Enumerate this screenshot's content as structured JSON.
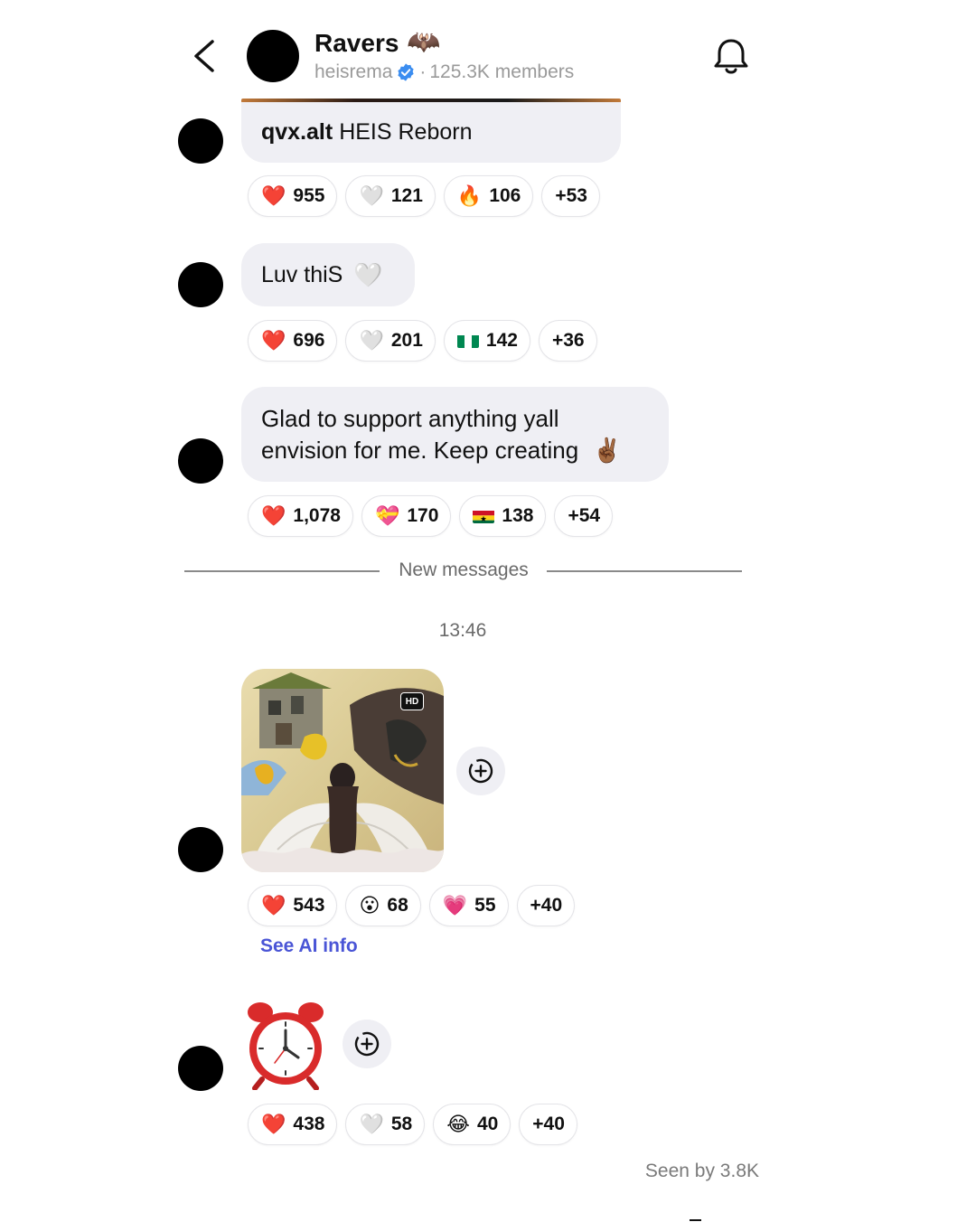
{
  "header": {
    "back_icon": "chevron-left-icon",
    "group_name": "Ravers",
    "group_emoji": "🦇",
    "owner": "heisrema",
    "verified_icon": "verified-badge-icon",
    "separator": "·",
    "members": "125.3K members",
    "bell_icon": "bell-icon"
  },
  "messages": [
    {
      "sender": "qvx.alt",
      "text": "HEIS Reborn",
      "reactions": [
        {
          "emoji": "❤️",
          "count": "955"
        },
        {
          "emoji": "🤍",
          "count": "121"
        },
        {
          "emoji": "🔥",
          "count": "106"
        },
        {
          "emoji": "",
          "count": "+53"
        }
      ]
    },
    {
      "text": "Luv thiS",
      "emoji": "🤍",
      "reactions": [
        {
          "emoji": "❤️",
          "count": "696"
        },
        {
          "emoji": "🤍",
          "count": "201"
        },
        {
          "emoji": "flag-nigeria",
          "count": "142"
        },
        {
          "emoji": "",
          "count": "+36"
        }
      ]
    },
    {
      "line1": "Glad to support anything yall",
      "line2": "envision for me. Keep creating",
      "emoji": "✌🏾",
      "reactions": [
        {
          "emoji": "❤️",
          "count": "1,078"
        },
        {
          "emoji": "💝",
          "count": "170"
        },
        {
          "emoji": "flag-ghana",
          "count": "138"
        },
        {
          "emoji": "",
          "count": "+54"
        }
      ]
    },
    {
      "hd_label": "HD",
      "add_icon": "add-reaction-icon",
      "reactions": [
        {
          "emoji": "❤️",
          "count": "543"
        },
        {
          "emoji": "😮",
          "count": "68"
        },
        {
          "emoji": "💗",
          "count": "55"
        },
        {
          "emoji": "",
          "count": "+40"
        }
      ],
      "link": "See AI info"
    },
    {
      "emoji": "⏰",
      "add_icon": "add-reaction-icon",
      "reactions": [
        {
          "emoji": "❤️",
          "count": "438"
        },
        {
          "emoji": "🤍",
          "count": "58"
        },
        {
          "emoji": "😂",
          "count": "40"
        },
        {
          "emoji": "",
          "count": "+40"
        }
      ]
    }
  ],
  "divider": {
    "label": "New messages"
  },
  "timestamp": "13:46",
  "seen": "Seen by 3.8K",
  "colors": {
    "link": "#4a55d6",
    "bubble": "#efeff4",
    "verified": "#3b8df0"
  }
}
